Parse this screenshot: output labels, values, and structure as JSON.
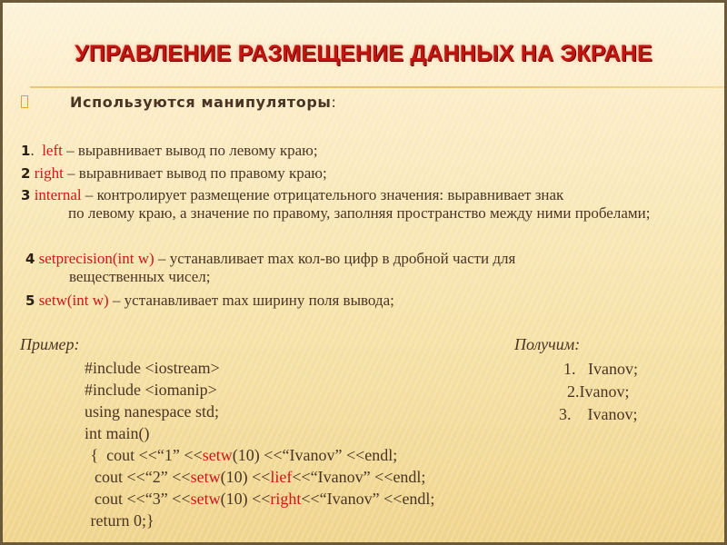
{
  "title": "УПРАВЛЕНИЕ РАЗМЕЩЕНИЕ ДАННЫХ НА ЭКРАНЕ",
  "subheading": {
    "bullet_icon": "square-bullet-icon",
    "text": "Используются манипуляторы",
    "colon": ":"
  },
  "items": [
    {
      "num": "1",
      "sep": ". ",
      "keyword": "left",
      "text": " – выравнивает вывод по левому краю;",
      "cont": ""
    },
    {
      "num": "2",
      "sep": " ",
      "keyword": "right",
      "text": " – выравнивает вывод по правому краю;",
      "cont": ""
    },
    {
      "num": "3",
      "sep": " ",
      "keyword": "internal",
      "text": " – контролирует размещение отрицательного значения: выравнивает знак",
      "cont": "по левому краю, а значение по правому, заполняя пространство между ними пробелами;"
    },
    {
      "num": "4",
      "sep": " ",
      "keyword": "setprecision(int w)",
      "text": " – устанавливает max кол-во цифр в дробной части для",
      "cont": "вещественных чисел;"
    },
    {
      "num": "5",
      "sep": " ",
      "keyword": "setw(int w)",
      "text": " – устанавливает max ширину поля вывода;",
      "cont": ""
    }
  ],
  "example": {
    "label": "Пример:",
    "lines": [
      {
        "parts": [
          {
            "t": "#include <iostream>",
            "kw": false
          }
        ]
      },
      {
        "parts": [
          {
            "t": "#include <iomanip>",
            "kw": false
          }
        ]
      },
      {
        "parts": [
          {
            "t": "using nanespace std;",
            "kw": false
          }
        ]
      },
      {
        "parts": [
          {
            "t": "int main()",
            "kw": false
          }
        ]
      },
      {
        "parts": [
          {
            "t": " {  cout <<“1” <<",
            "kw": false
          },
          {
            "t": "setw",
            "kw": true
          },
          {
            "t": "(10) <<“Ivanov” <<endl;",
            "kw": false
          }
        ]
      },
      {
        "parts": [
          {
            "t": "  cout <<“2” <<",
            "kw": false
          },
          {
            "t": "setw",
            "kw": true
          },
          {
            "t": "(10) <<",
            "kw": false
          },
          {
            "t": "lief",
            "kw": true
          },
          {
            "t": "<<“Ivanov” <<endl;",
            "kw": false
          }
        ]
      },
      {
        "parts": [
          {
            "t": "  cout <<“3” <<",
            "kw": false
          },
          {
            "t": "setw",
            "kw": true
          },
          {
            "t": "(10) <<",
            "kw": false
          },
          {
            "t": "right",
            "kw": true
          },
          {
            "t": "<<“Ivanov” <<endl;",
            "kw": false
          }
        ]
      },
      {
        "parts": [
          {
            "t": " return 0;}",
            "kw": false
          }
        ]
      }
    ]
  },
  "result": {
    "label": "Получим:",
    "lines": [
      "1.   Ivanov;",
      "2.Ivanov;",
      "3.    Ivanov;"
    ]
  },
  "colors": {
    "accent": "#c4140f",
    "keyword": "#d0161a",
    "text": "#4a3424"
  }
}
